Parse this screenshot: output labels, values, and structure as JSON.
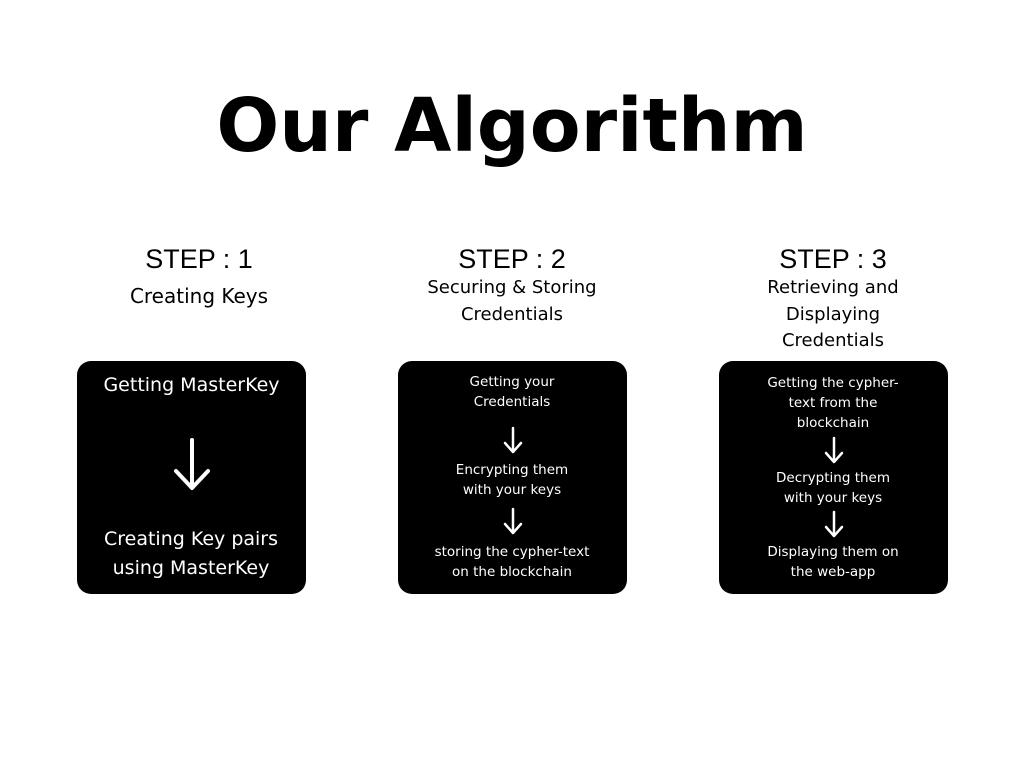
{
  "title": "Our Algorithm",
  "steps": [
    {
      "heading": "STEP : 1",
      "subtitle": "Creating Keys",
      "card": {
        "items": [
          "Getting MasterKey",
          "Creating Key pairs using MasterKey"
        ]
      }
    },
    {
      "heading": "STEP : 2",
      "subtitle": "Securing & Storing Credentials",
      "card": {
        "items": [
          "Getting your Credentials",
          "Encrypting them with your keys",
          "storing the cypher-text on the blockchain"
        ]
      }
    },
    {
      "heading": "STEP : 3",
      "subtitle": "Retrieving and Displaying Credentials",
      "card": {
        "items": [
          "Getting the cypher-text from the blockchain",
          "Decrypting them with your keys",
          "Displaying them on the web-app"
        ]
      }
    }
  ],
  "icons": {
    "arrow": "arrow-down-icon"
  }
}
